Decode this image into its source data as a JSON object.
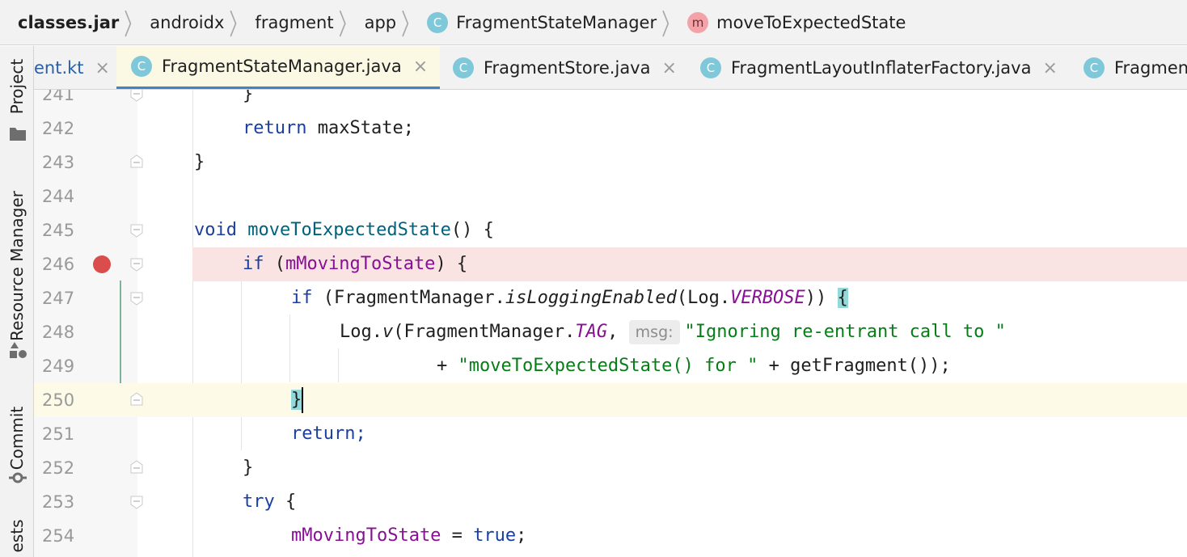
{
  "breadcrumb": {
    "items": [
      {
        "label": "classes.jar",
        "icon": null
      },
      {
        "label": "androidx",
        "icon": null
      },
      {
        "label": "fragment",
        "icon": null
      },
      {
        "label": "app",
        "icon": null
      },
      {
        "label": "FragmentStateManager",
        "icon": "class-icon",
        "icon_letter": "C"
      },
      {
        "label": "moveToExpectedState",
        "icon": "method-icon",
        "icon_letter": "m"
      }
    ]
  },
  "toolstrip": {
    "items": [
      {
        "label": "Project",
        "icon": "folder-icon"
      },
      {
        "label": "Resource Manager",
        "icon": "shapes-icon"
      },
      {
        "label": "Commit",
        "icon": "commit-icon"
      },
      {
        "label": "ests",
        "icon": null
      }
    ]
  },
  "tabs": [
    {
      "label": "ent.kt",
      "active": false,
      "icon": null,
      "close": "×"
    },
    {
      "label": "FragmentStateManager.java",
      "active": true,
      "icon": "class-icon",
      "icon_letter": "C",
      "close": "×"
    },
    {
      "label": "FragmentStore.java",
      "active": false,
      "icon": "class-icon",
      "icon_letter": "C",
      "close": "×"
    },
    {
      "label": "FragmentLayoutInflaterFactory.java",
      "active": false,
      "icon": "class-icon",
      "icon_letter": "C",
      "close": "×"
    },
    {
      "label": "Fragmen",
      "active": false,
      "icon": "class-icon",
      "icon_letter": "C",
      "close": ""
    }
  ],
  "editor": {
    "lines": [
      {
        "num": "241",
        "code": "}"
      },
      {
        "num": "242",
        "code": "return maxState;"
      },
      {
        "num": "243",
        "code": "}"
      },
      {
        "num": "244",
        "code": ""
      },
      {
        "num": "245",
        "code": "void moveToExpectedState() {"
      },
      {
        "num": "246",
        "code": "if (mMovingToState) {",
        "breakpoint": true
      },
      {
        "num": "247",
        "code": "if (FragmentManager.isLoggingEnabled(Log.VERBOSE)) {"
      },
      {
        "num": "248",
        "code": "Log.v(FragmentManager.TAG, msg: \"Ignoring re-entrant call to \""
      },
      {
        "num": "249",
        "code": "+ \"moveToExpectedState() for \" + getFragment());"
      },
      {
        "num": "250",
        "code": "}",
        "current": true
      },
      {
        "num": "251",
        "code": "return;"
      },
      {
        "num": "252",
        "code": "}"
      },
      {
        "num": "253",
        "code": "try {"
      },
      {
        "num": "254",
        "code": "mMovingToState = true;"
      }
    ],
    "tokens": {
      "return": "return",
      "maxState": "maxState;",
      "void": "void",
      "moveToExpectedState": "moveToExpectedState",
      "parens_open": "() {",
      "if": "if",
      "mMovingToState": "mMovingToState",
      "if_close": ") {",
      "FragmentManager_dot": "(FragmentManager.",
      "isLoggingEnabled": "isLoggingEnabled",
      "Log_dot": "(Log.",
      "VERBOSE": "VERBOSE",
      "close_paren2": "))",
      "brace_open": "{",
      "Log_v": "Log.",
      "v": "v",
      "FragmentManager_paren": "(FragmentManager.",
      "TAG": "TAG",
      "comma": ",",
      "msg_hint": "msg:",
      "str1": "\"Ignoring re-entrant call to \"",
      "plus": "+ ",
      "str2": "\"moveToExpectedState() for \"",
      "rest249": " + getFragment());",
      "brace_close": "}",
      "return_semi": "return;",
      "try": "try",
      "brace_space": " {",
      "assign": " = ",
      "true": "true",
      "semi": ";"
    }
  },
  "colors": {
    "keyword": "#1a3fa3",
    "method_decl": "#00627a",
    "field": "#871094",
    "string": "#067d17",
    "breakpoint": "#db4c4c",
    "breakpoint_line": "#f9e3e3",
    "current_line": "#fdfbe8",
    "active_tab_underline": "#4083c9"
  }
}
